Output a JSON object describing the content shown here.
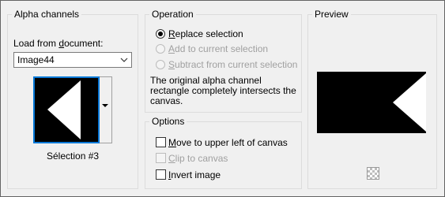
{
  "alpha": {
    "legend": "Alpha channels",
    "load_label_pre": "Load from ",
    "load_label_u": "d",
    "load_label_post": "ocument:",
    "document_value": "Image44",
    "selection_name": "Sélection #3"
  },
  "operation": {
    "legend": "Operation",
    "replace_u": "R",
    "replace_rest": "eplace selection",
    "add_u": "A",
    "add_rest": "dd to current selection",
    "subtract_u": "S",
    "subtract_rest": "ubtract from current selection",
    "selected": "replace",
    "description": [
      "The original alpha channel",
      "rectangle completely intersects the",
      "canvas."
    ]
  },
  "options": {
    "legend": "Options",
    "move_u": "M",
    "move_rest": "ove to upper left of canvas",
    "move_checked": false,
    "clip_u": "C",
    "clip_rest": "lip to canvas",
    "clip_checked": false,
    "invert_u": "I",
    "invert_rest": "nvert image",
    "invert_checked": false
  },
  "preview": {
    "legend": "Preview"
  },
  "colors": {
    "focus": "#0078d7",
    "disabled_text": "#a0a0a0"
  }
}
